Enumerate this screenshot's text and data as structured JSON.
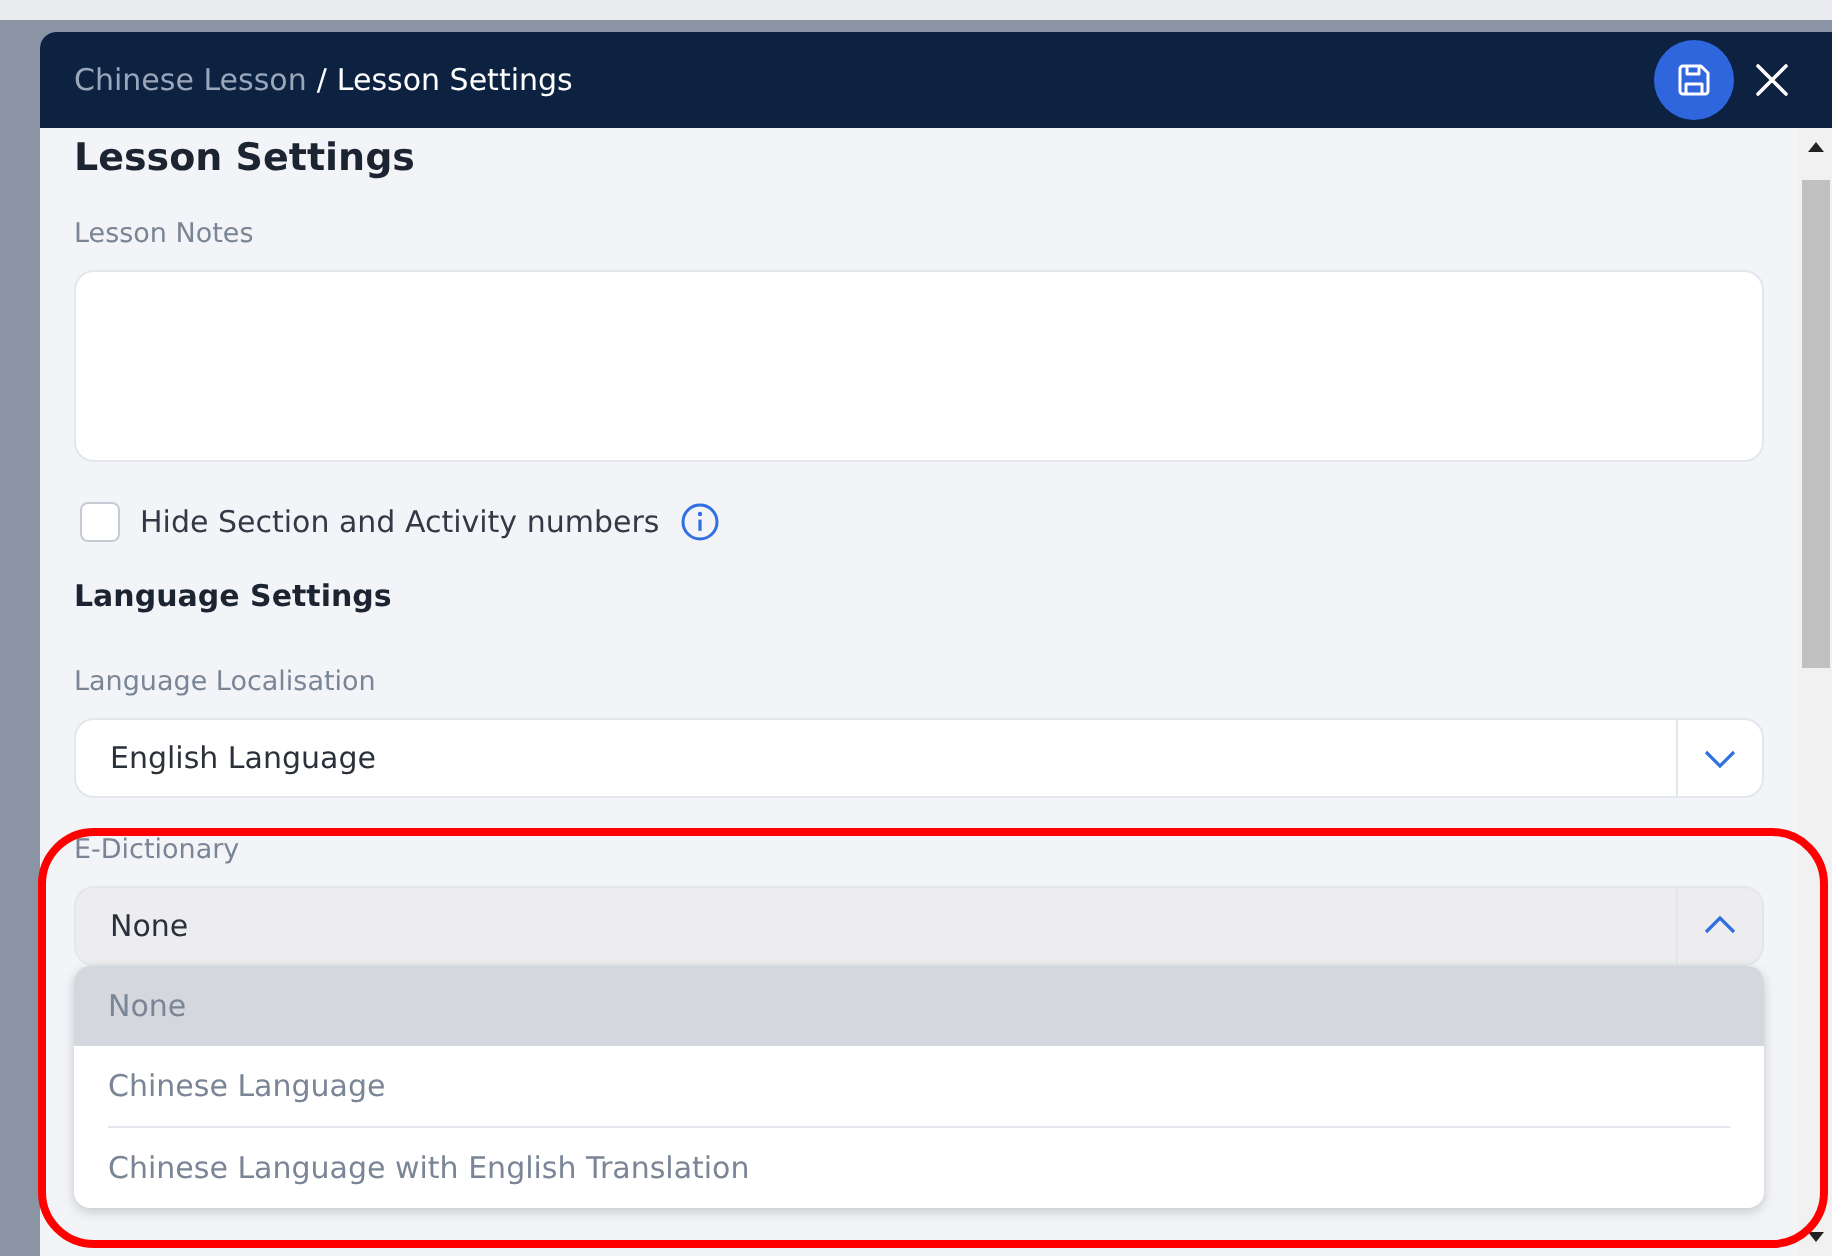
{
  "window": {
    "breadcrumb": [
      {
        "label": "Chinese Lesson",
        "current": false
      },
      {
        "label": "Lesson Settings",
        "current": true
      }
    ],
    "separator": "/"
  },
  "page_title": "Lesson Settings",
  "lesson_notes": {
    "label": "Lesson Notes"
  },
  "hide_numbers": {
    "label": "Hide Section and Activity numbers",
    "checked": false
  },
  "language_settings": {
    "heading": "Language Settings",
    "localisation": {
      "label": "Language Localisation",
      "value": "English Language",
      "expanded": false
    },
    "e_dictionary": {
      "label": "E-Dictionary",
      "value": "None",
      "expanded": true,
      "options": [
        {
          "label": "None",
          "selected": true
        },
        {
          "label": "Chinese Language",
          "selected": false
        },
        {
          "label": "Chinese Language with English Translation",
          "selected": false
        }
      ]
    }
  }
}
